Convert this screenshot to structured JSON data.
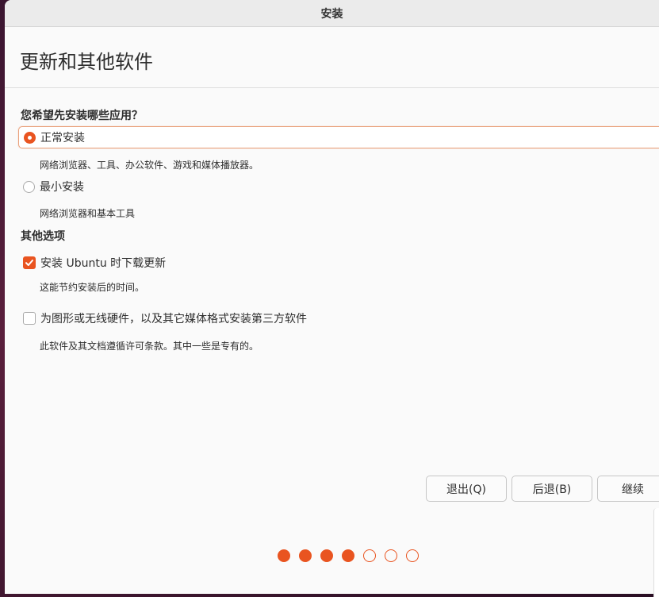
{
  "window": {
    "title": "安装"
  },
  "header": {
    "title": "更新和其他软件"
  },
  "install_type": {
    "question": "您希望先安装哪些应用？",
    "options": [
      {
        "label": "正常安装",
        "description": "网络浏览器、工具、办公软件、游戏和媒体播放器。",
        "selected": true
      },
      {
        "label": "最小安装",
        "description": "网络浏览器和基本工具",
        "selected": false
      }
    ]
  },
  "other_options": {
    "title": "其他选项",
    "items": [
      {
        "label": "安装 Ubuntu 时下载更新",
        "description": "这能节约安装后的时间。",
        "checked": true
      },
      {
        "label": "为图形或无线硬件，以及其它媒体格式安装第三方软件",
        "description": "此软件及其文档遵循许可条款。其中一些是专有的。",
        "checked": false
      }
    ]
  },
  "buttons": {
    "quit": "退出(Q)",
    "back": "后退(B)",
    "continue": "继续"
  },
  "progress": {
    "current_step": 4,
    "total_steps": 7
  },
  "colors": {
    "accent": "#e95420"
  }
}
